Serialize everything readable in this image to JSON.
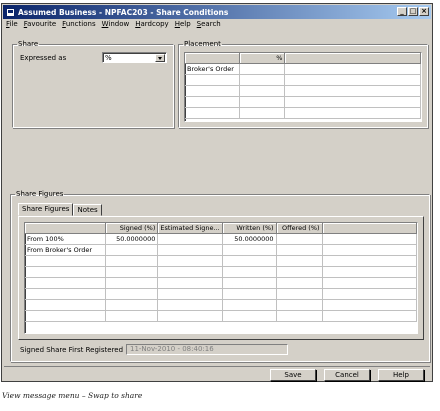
{
  "window": {
    "title": "Assumed Business - NPFAC203 - Share Conditions",
    "controls": [
      "_",
      "□",
      "×"
    ]
  },
  "menu": [
    "File",
    "Favourite",
    "Functions",
    "Window",
    "Hardcopy",
    "Help",
    "Search"
  ],
  "share_group": {
    "legend": "Share",
    "expressed_as_label": "Expressed as",
    "expressed_as_value": "%"
  },
  "placement_group": {
    "legend": "Placement",
    "headers": [
      "",
      "%",
      ""
    ],
    "rows": [
      [
        "Broker's Order",
        "",
        ""
      ],
      [
        "",
        "",
        ""
      ],
      [
        "",
        "",
        ""
      ],
      [
        "",
        "",
        ""
      ],
      [
        "",
        "",
        ""
      ]
    ]
  },
  "share_figures_group": {
    "legend": "Share Figures",
    "tabs": [
      "Share Figures",
      "Notes"
    ],
    "headers": [
      "",
      "Signed (%)",
      "Estimated Signe...",
      "Written (%)",
      "Offered (%)",
      ""
    ],
    "rows": [
      [
        "From 100%",
        "50.0000000",
        "",
        "50.0000000",
        "",
        ""
      ],
      [
        "From Broker's Order",
        "",
        "",
        "",
        "",
        ""
      ],
      [
        "",
        "",
        "",
        "",
        "",
        ""
      ],
      [
        "",
        "",
        "",
        "",
        "",
        ""
      ],
      [
        "",
        "",
        "",
        "",
        "",
        ""
      ],
      [
        "",
        "",
        "",
        "",
        "",
        ""
      ],
      [
        "",
        "",
        "",
        "",
        "",
        ""
      ],
      [
        "",
        "",
        "",
        "",
        "",
        ""
      ]
    ],
    "signed_first_registered_label": "Signed Share First Registered",
    "signed_first_registered_value": "11-Nov-2010 - 08:40:16"
  },
  "buttons": {
    "save": "Save",
    "cancel": "Cancel",
    "help": "Help"
  },
  "caption": "View message menu – Swap to share"
}
